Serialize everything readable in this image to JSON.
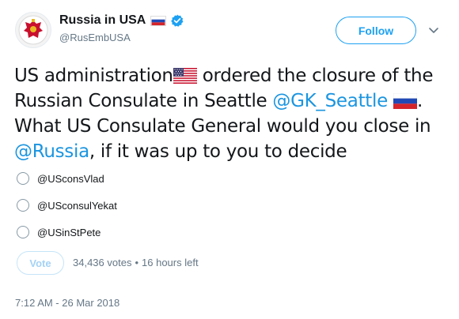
{
  "account": {
    "display_name": "Russia in USA",
    "handle": "@RusEmbUSA",
    "verified": true,
    "avatar_icon": "russian-coat-of-arms-icon"
  },
  "follow_button": {
    "label": "Follow"
  },
  "tweet": {
    "segments": [
      {
        "text": "US administration",
        "type": "text"
      },
      {
        "type": "flag",
        "icon": "us-flag-icon"
      },
      {
        "text": " ordered the closure of the Russian Consulate in Seattle ",
        "type": "text"
      },
      {
        "text": "@GK_Seattle",
        "type": "mention"
      },
      {
        "text": " ",
        "type": "text"
      },
      {
        "type": "flag",
        "icon": "russia-flag-icon"
      },
      {
        "text": ". What US Consulate General would you close in ",
        "type": "text"
      },
      {
        "text": "@Russia",
        "type": "mention"
      },
      {
        "text": ", if it was up to you to decide",
        "type": "text"
      }
    ],
    "text_1": "US administration",
    "text_2": " ordered the closure of the Russian Consulate in Seattle ",
    "mention_1": "@GK_Seattle",
    "text_3": ". What US Consulate General would you close in ",
    "mention_2": "@Russia",
    "text_4": ", if it was up to you to decide"
  },
  "poll": {
    "options": [
      {
        "label": "@USconsVlad"
      },
      {
        "label": "@USconsulYekat"
      },
      {
        "label": "@USinStPete"
      }
    ],
    "vote_label": "Vote",
    "votes": "34,436 votes",
    "separator": "•",
    "time_left": "16 hours left"
  },
  "timestamp": "7:12 AM - 26 Mar 2018",
  "colors": {
    "link": "#1b95e0",
    "follow": "#1da1f2",
    "muted": "#657786",
    "text": "#14171a"
  }
}
